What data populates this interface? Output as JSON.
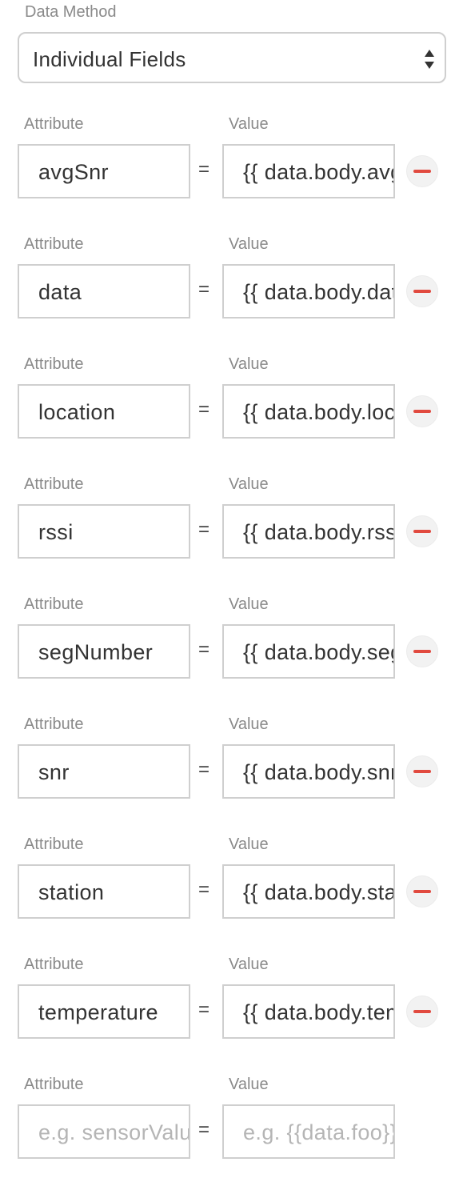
{
  "data_method": {
    "label": "Data Method",
    "selected": "Individual Fields"
  },
  "labels": {
    "attribute": "Attribute",
    "value": "Value",
    "equals": "="
  },
  "rows": [
    {
      "attribute": "avgSnr",
      "value": "{{ data.body.avgSnr }}"
    },
    {
      "attribute": "data",
      "value": "{{ data.body.data }}"
    },
    {
      "attribute": "location",
      "value": "{{ data.body.location }}"
    },
    {
      "attribute": "rssi",
      "value": "{{ data.body.rssi }}"
    },
    {
      "attribute": "segNumber",
      "value": "{{ data.body.segNumber }}"
    },
    {
      "attribute": "snr",
      "value": "{{ data.body.snr }}"
    },
    {
      "attribute": "station",
      "value": "{{ data.body.station }}"
    },
    {
      "attribute": "temperature",
      "value": "{{ data.body.temperature }}"
    }
  ],
  "new_row": {
    "attribute_placeholder": "e.g. sensorValue",
    "value_placeholder": "e.g. {{data.foo}}"
  },
  "colors": {
    "remove_accent": "#e14a3f",
    "border": "#cfcfcf",
    "label": "#8a8a8a"
  }
}
